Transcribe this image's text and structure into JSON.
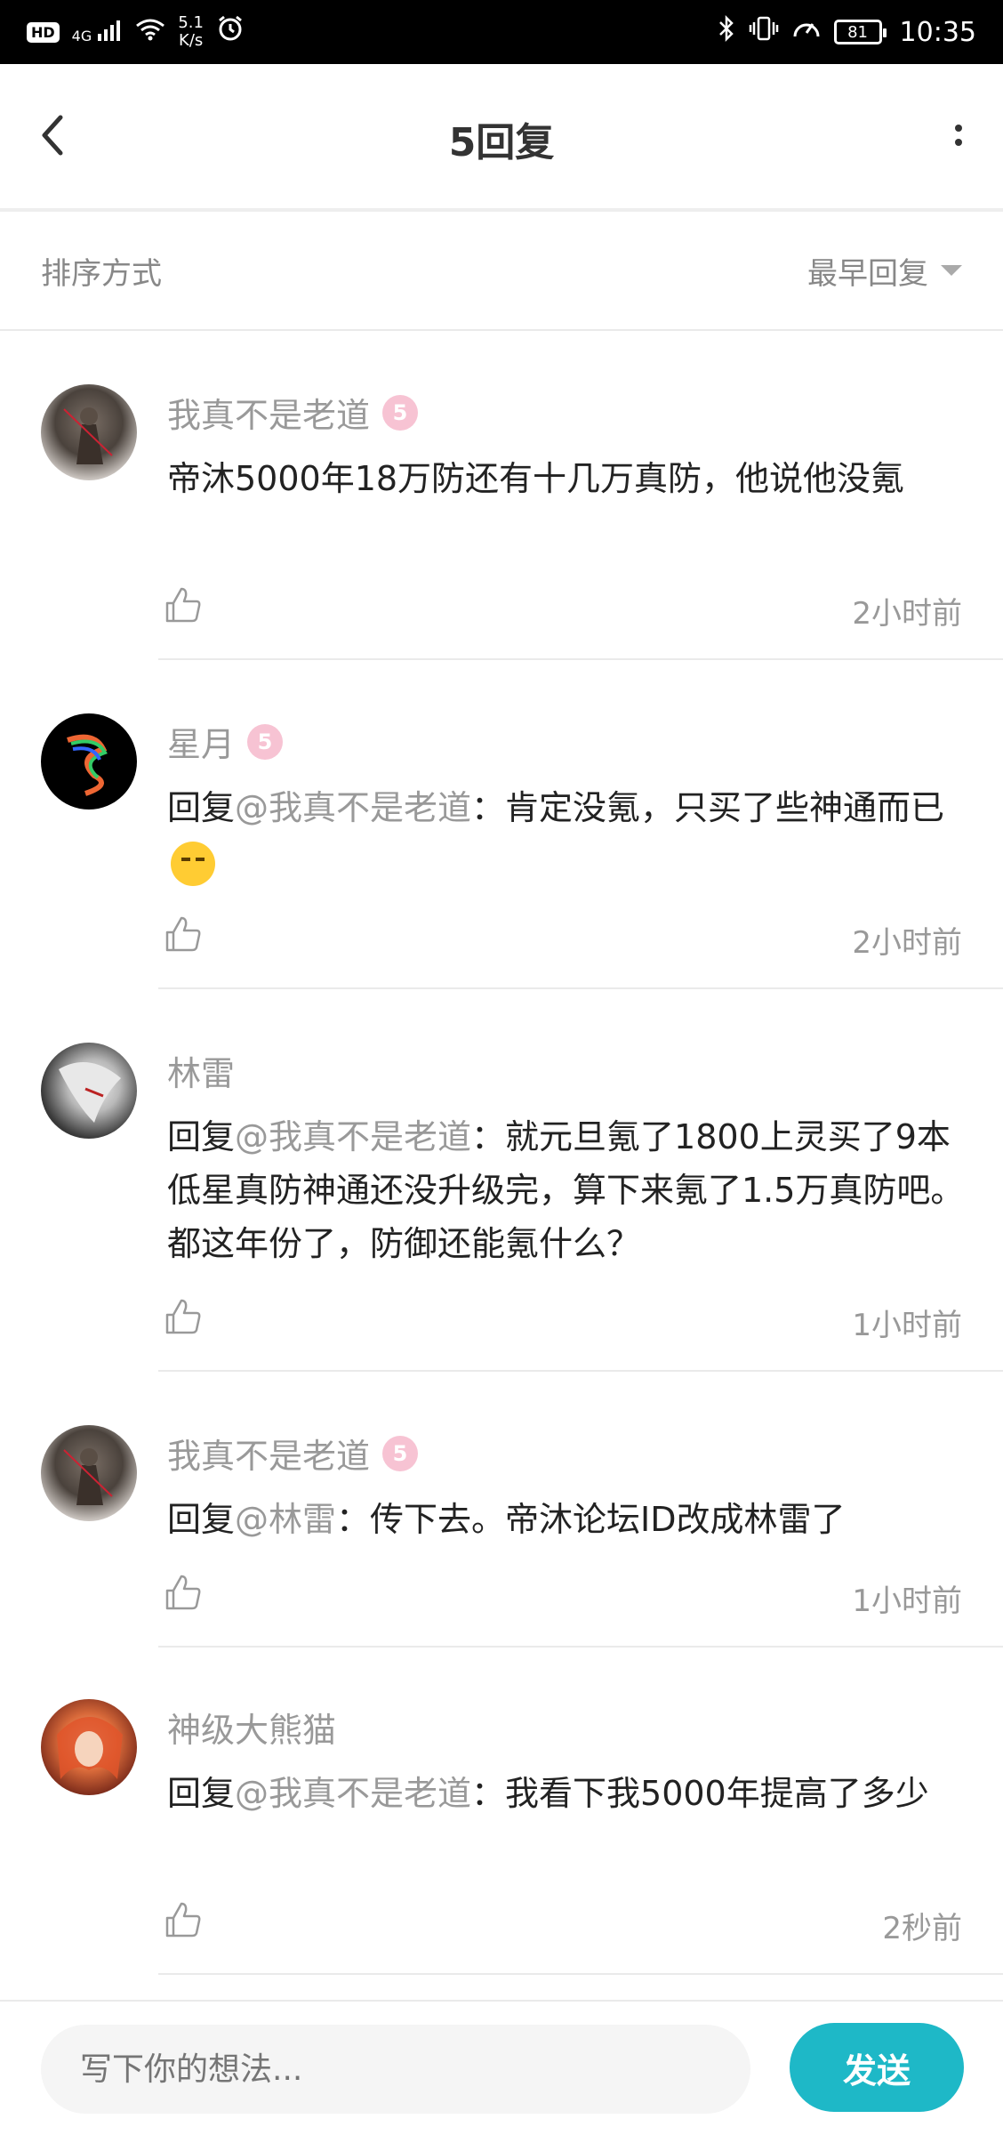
{
  "status_bar": {
    "network": "4G",
    "speed_value": "5.1",
    "speed_unit": "K/s",
    "battery": "81",
    "time": "10:35"
  },
  "header": {
    "title": "5回复"
  },
  "sort": {
    "label": "排序方式",
    "selected": "最早回复"
  },
  "comments": [
    {
      "author": "我真不是老道",
      "level": "5",
      "mention": "",
      "text": "帝沐5000年18万防还有十几万真防，他说他没氪",
      "time": "2小时前"
    },
    {
      "author": "星月",
      "level": "5",
      "mention": "@我真不是老道",
      "text": "：肯定没氪，只买了些神通而已",
      "time": "2小时前"
    },
    {
      "author": "林雷",
      "level": "",
      "mention": "@我真不是老道",
      "text": "：就元旦氪了1800上灵买了9本低星真防神通还没升级完，算下来氪了1.5万真防吧。都这年份了，防御还能氪什么？",
      "time": "1小时前"
    },
    {
      "author": "我真不是老道",
      "level": "5",
      "mention": "@林雷",
      "text": "：传下去。帝沐论坛ID改成林雷了",
      "time": "1小时前"
    },
    {
      "author": "神级大熊猫",
      "level": "",
      "mention": "@我真不是老道",
      "text": "：我看下我5000年提高了多少",
      "time": "2秒前"
    }
  ],
  "reply_prefix": "回复",
  "input": {
    "placeholder": "写下你的想法..."
  },
  "send_label": "发送",
  "colors": {
    "accent": "#1eb8c7",
    "muted_text": "#999999",
    "level_badge": "#f7c3d3"
  }
}
